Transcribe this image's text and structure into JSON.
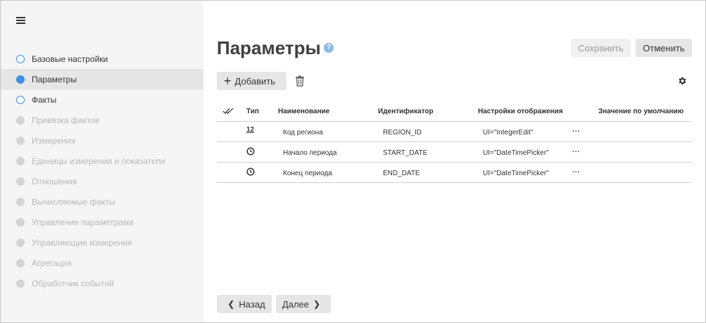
{
  "sidebar": {
    "steps": [
      {
        "label": "Базовые настройки",
        "state": "open"
      },
      {
        "label": "Параметры",
        "state": "current"
      },
      {
        "label": "Факты",
        "state": "open"
      },
      {
        "label": "Привязка фактов",
        "state": "disabled"
      },
      {
        "label": "Измерения",
        "state": "disabled"
      },
      {
        "label": "Единицы измерения и показатели",
        "state": "disabled"
      },
      {
        "label": "Отношения",
        "state": "disabled"
      },
      {
        "label": "Вычисляемые факты",
        "state": "disabled"
      },
      {
        "label": "Управление параметрами",
        "state": "disabled"
      },
      {
        "label": "Управляющие измерения",
        "state": "disabled"
      },
      {
        "label": "Агрегация",
        "state": "disabled"
      },
      {
        "label": "Обработчик событий",
        "state": "disabled"
      }
    ]
  },
  "header": {
    "title": "Параметры",
    "help": "?",
    "save_label": "Сохранить",
    "cancel_label": "Отменить"
  },
  "toolbar": {
    "add_label": "Добавить"
  },
  "table": {
    "columns": {
      "type": "Тип",
      "name": "Наименование",
      "id": "Идентификатор",
      "display": "Настройки отображения",
      "default": "Значение по умолчанию"
    },
    "rows": [
      {
        "type_icon": "integer",
        "type_text": "12",
        "name": "Код региона",
        "id": "REGION_ID",
        "display": "UI=\"IntegerEdit\"",
        "more": "···"
      },
      {
        "type_icon": "clock",
        "name": "Начало периода",
        "id": "START_DATE",
        "display": "UI=\"DateTimePicker\"",
        "more": "···"
      },
      {
        "type_icon": "clock",
        "name": "Конец периода",
        "id": "END_DATE",
        "display": "UI=\"DateTimePicker\"",
        "more": "···"
      }
    ]
  },
  "footer": {
    "back_label": "Назад",
    "next_label": "Далее"
  },
  "colors": {
    "accent": "#3d8fe3",
    "sidebar_bg": "#f5f5f5",
    "active_bg": "#e6e6e6",
    "disabled": "#b7b7b7"
  }
}
